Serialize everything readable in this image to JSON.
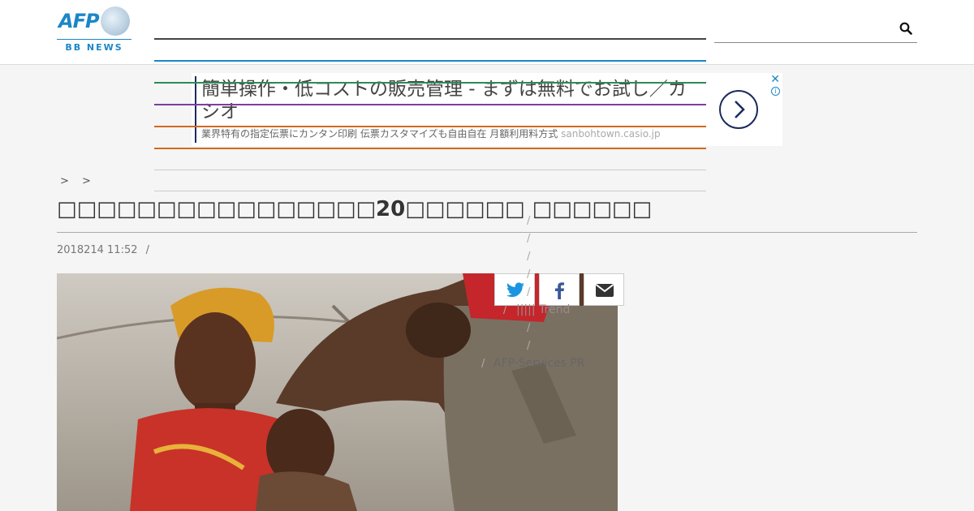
{
  "header": {
    "logo_text": "AFP",
    "logo_sub": "BB NEWS",
    "search_placeholder": ""
  },
  "ad": {
    "title": "簡単操作・低コストの販売管理 - まずは無料でお試し／カシオ",
    "description": "業界特有の指定伝票にカンタン印刷 伝票カスタマイズも自由自在 月額利用料方式",
    "domain": "sanbohtown.casio.jp",
    "close_glyph": "✕",
    "info_glyph": "i"
  },
  "breadcrumb": "> >",
  "article": {
    "title": "□□□□□□□□□□□□□□□□20□□□□□□ □□□□□□",
    "date": "2018214 11:52",
    "separator": "/"
  },
  "sidebar": {
    "slashes": [
      "/",
      "/",
      "/",
      "/",
      "/",
      "/",
      "/",
      "/",
      "/"
    ],
    "trend_label": "||||| Trend",
    "services_label": "AFP-Services PR"
  },
  "share": {
    "twitter": "twitter-icon",
    "facebook": "facebook-icon",
    "email": "envelope-icon"
  },
  "colors": {
    "brand": "#1b86c8",
    "ad_accent": "#1d2b5c",
    "page_bg": "#f5f5f5"
  }
}
